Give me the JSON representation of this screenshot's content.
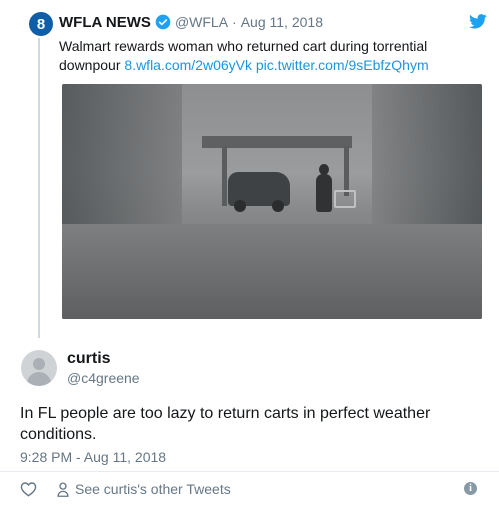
{
  "quoted_tweet": {
    "avatar_text": "8",
    "name": "WFLA NEWS",
    "handle": "@WFLA",
    "separator": "·",
    "date": "Aug 11, 2018",
    "text": "Walmart rewards woman who returned cart during torrential downpour",
    "links": [
      "8.wfla.com/2w06yVk",
      "pic.twitter.com/9sEbfzQhym"
    ],
    "colors": {
      "verified": "#1da1f2",
      "bird": "#1da1f2",
      "link": "#1b95e0",
      "avatar": "#0f5ea8"
    }
  },
  "tweet": {
    "name": "curtis",
    "handle": "@c4greene",
    "text": "In FL people are too lazy to return carts in perfect weather conditions.",
    "timestamp": "9:28 PM - Aug 11, 2018",
    "other_tweets_label": "See curtis's other Tweets"
  },
  "icons": [
    "verified-icon",
    "twitter-bird-icon",
    "heart-icon",
    "person-icon",
    "info-icon"
  ]
}
